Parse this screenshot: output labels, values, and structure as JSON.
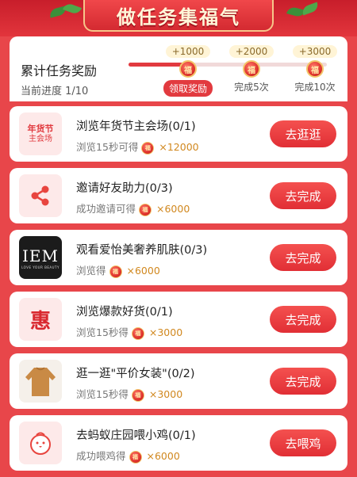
{
  "banner": {
    "title": "做任务集福气"
  },
  "progress": {
    "title": "累计任务奖励",
    "current": "当前进度 1/10",
    "fill_fraction": 0.1,
    "milestones": [
      {
        "reward": "+1000",
        "label": "领取奖励",
        "claimable": true
      },
      {
        "reward": "+2000",
        "label": "完成5次",
        "claimable": false
      },
      {
        "reward": "+3000",
        "label": "完成10次",
        "claimable": false
      }
    ],
    "coin_glyph": "福"
  },
  "tasks": [
    {
      "thumb": "festival-thumb",
      "thumb_line1": "年货节",
      "thumb_line2": "主会场",
      "title": "浏览年货节主会场(0/1)",
      "sub": "浏览15秒可得",
      "amount": "×12000",
      "button": "去逛逛"
    },
    {
      "thumb": "share-icon",
      "title": "邀请好友助力(0/3)",
      "sub": "成功邀请可得",
      "amount": "×6000",
      "button": "去完成"
    },
    {
      "thumb": "iem-logo",
      "logo_text": "IEM",
      "logo_tag": "LOVE YOUR BEAUTY",
      "title": "观看爱怡美奢养肌肤(0/3)",
      "sub": "浏览得",
      "amount": "×6000",
      "button": "去完成"
    },
    {
      "thumb": "hui-icon",
      "thumb_char": "惠",
      "title": "浏览爆款好货(0/1)",
      "sub": "浏览15秒得",
      "amount": "×3000",
      "button": "去完成"
    },
    {
      "thumb": "sweater-image",
      "title": "逛一逛\"平价女装\"(0/2)",
      "sub": "浏览15秒得",
      "amount": "×3000",
      "button": "去完成"
    },
    {
      "thumb": "chick-icon",
      "title": "去蚂蚁庄园喂小鸡(0/1)",
      "sub": "成功喂鸡得",
      "amount": "×6000",
      "button": "去喂鸡"
    }
  ],
  "colors": {
    "brand_red": "#e23a3f",
    "gold": "#d1881f",
    "bg": "#e8464a"
  }
}
